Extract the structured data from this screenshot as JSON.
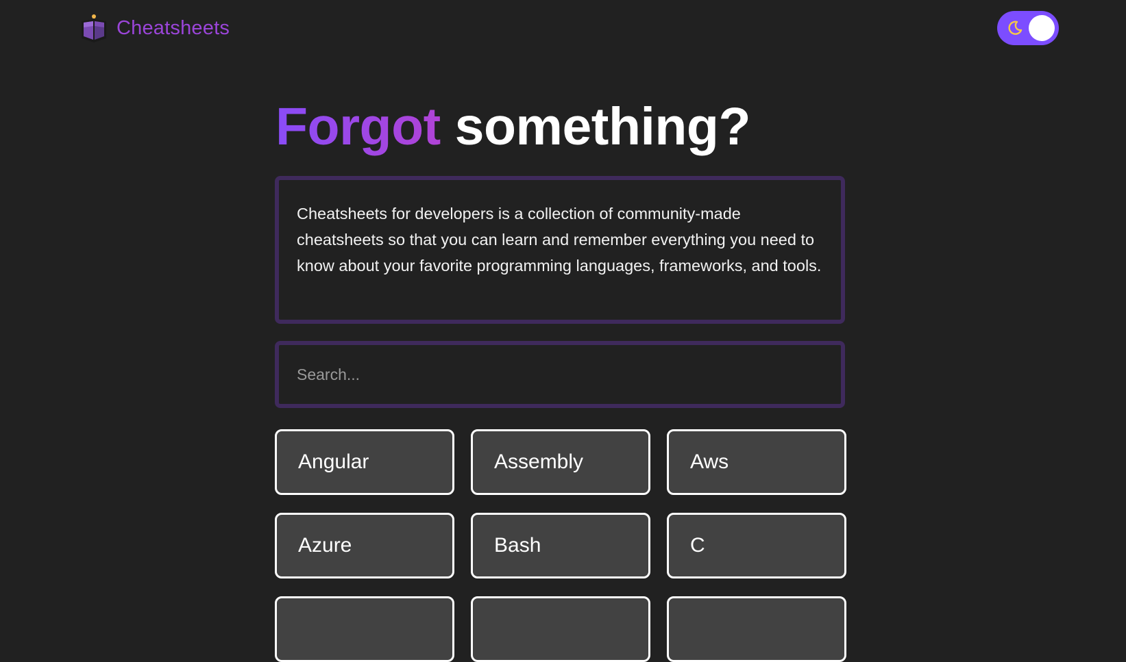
{
  "header": {
    "brand_name": "Cheatsheets",
    "logo_icon": "open-book-icon",
    "theme_toggle": {
      "icon": "moon-icon",
      "mode": "dark"
    }
  },
  "hero": {
    "title_accent": "Forgot",
    "title_rest": "something?"
  },
  "intro": {
    "text": "Cheatsheets for developers is a collection of community-made cheatsheets so that you can learn and remember everything you need to know about your favorite programming languages, frameworks, and tools."
  },
  "search": {
    "placeholder": "Search...",
    "value": ""
  },
  "cards": [
    {
      "label": "Angular"
    },
    {
      "label": "Assembly"
    },
    {
      "label": "Aws"
    },
    {
      "label": "Azure"
    },
    {
      "label": "Bash"
    },
    {
      "label": "C"
    },
    {
      "label": ""
    },
    {
      "label": ""
    },
    {
      "label": ""
    }
  ],
  "colors": {
    "background": "#212121",
    "brand": "#9b45d9",
    "toggle": "#7c4dff",
    "box_border": "#3f2a5c",
    "card_bg": "#424242"
  }
}
